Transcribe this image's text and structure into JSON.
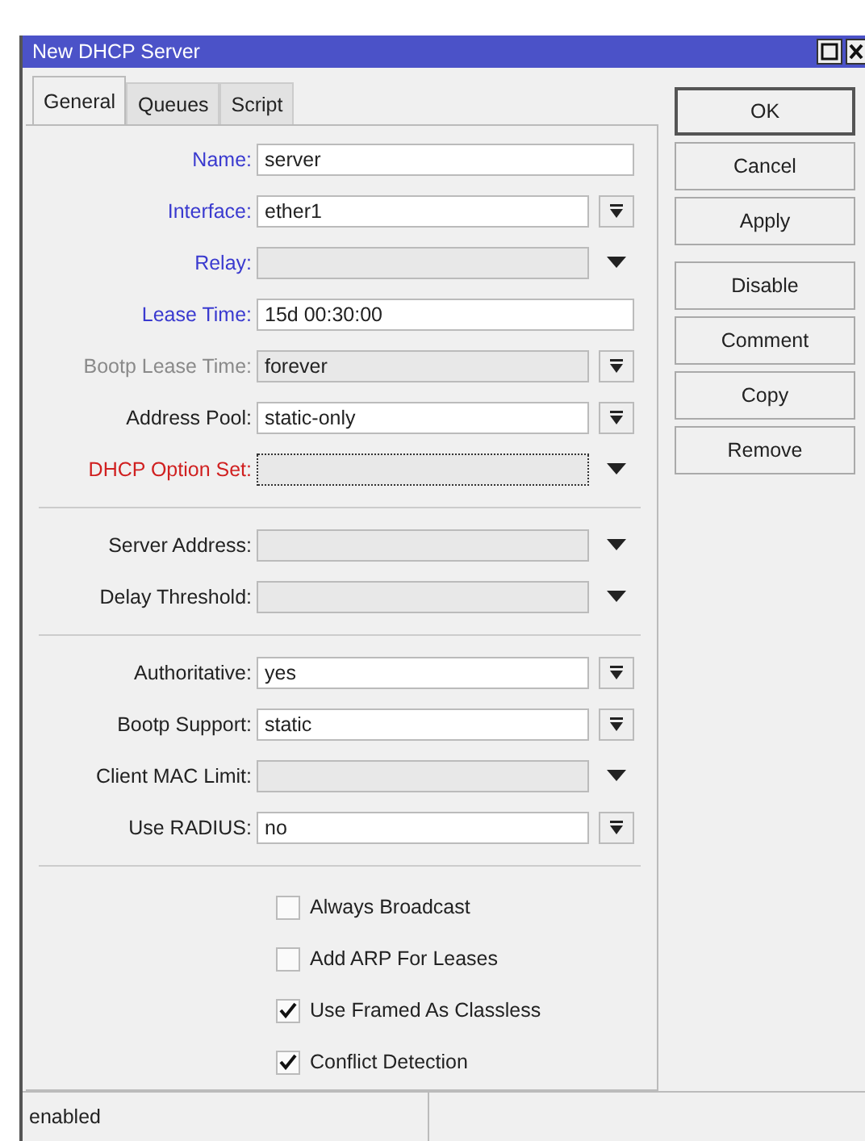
{
  "window": {
    "title": "New DHCP Server"
  },
  "tabs": [
    {
      "label": "General",
      "selected": true
    },
    {
      "label": "Queues",
      "selected": false
    },
    {
      "label": "Script",
      "selected": false
    }
  ],
  "field_groups": [
    [
      {
        "label": "Name:",
        "color": "#3a3acf",
        "kind": "text",
        "value": "server",
        "disabled": false,
        "focused": false
      },
      {
        "label": "Interface:",
        "color": "#3a3acf",
        "kind": "select",
        "value": "ether1",
        "disabled": false,
        "focused": false
      },
      {
        "label": "Relay:",
        "color": "#3a3acf",
        "kind": "dropdown",
        "focused": false
      },
      {
        "label": "Lease Time:",
        "color": "#3a3acf",
        "kind": "text",
        "value": "15d 00:30:00",
        "disabled": false,
        "focused": false
      },
      {
        "label": "Bootp Lease Time:",
        "color": "#8a8a8a",
        "kind": "select",
        "value": "forever",
        "disabled": true,
        "focused": false
      },
      {
        "label": "Address Pool:",
        "color": "#222222",
        "kind": "select",
        "value": "static-only",
        "disabled": false,
        "focused": false
      },
      {
        "label": "DHCP Option Set:",
        "color": "#d02020",
        "kind": "dropdown",
        "focused": true
      }
    ],
    [
      {
        "label": "Server Address:",
        "color": "#222222",
        "kind": "dropdown",
        "focused": false
      },
      {
        "label": "Delay Threshold:",
        "color": "#222222",
        "kind": "dropdown",
        "focused": false
      }
    ],
    [
      {
        "label": "Authoritative:",
        "color": "#222222",
        "kind": "select",
        "value": "yes",
        "disabled": false,
        "focused": false
      },
      {
        "label": "Bootp Support:",
        "color": "#222222",
        "kind": "select",
        "value": "static",
        "disabled": false,
        "focused": false
      },
      {
        "label": "Client MAC Limit:",
        "color": "#222222",
        "kind": "dropdown",
        "focused": false
      },
      {
        "label": "Use RADIUS:",
        "color": "#222222",
        "kind": "select",
        "value": "no",
        "disabled": false,
        "focused": false
      }
    ]
  ],
  "checkboxes": [
    {
      "label": "Always Broadcast",
      "checked": false
    },
    {
      "label": "Add ARP For Leases",
      "checked": false
    },
    {
      "label": "Use Framed As Classless",
      "checked": true
    },
    {
      "label": "Conflict Detection",
      "checked": true
    }
  ],
  "button_groups": [
    [
      {
        "label": "OK",
        "default": true
      },
      {
        "label": "Cancel",
        "default": false
      },
      {
        "label": "Apply",
        "default": false
      }
    ],
    [
      {
        "label": "Disable",
        "default": false
      },
      {
        "label": "Comment",
        "default": false
      },
      {
        "label": "Copy",
        "default": false
      },
      {
        "label": "Remove",
        "default": false
      }
    ]
  ],
  "status_bar": [
    "enabled"
  ]
}
